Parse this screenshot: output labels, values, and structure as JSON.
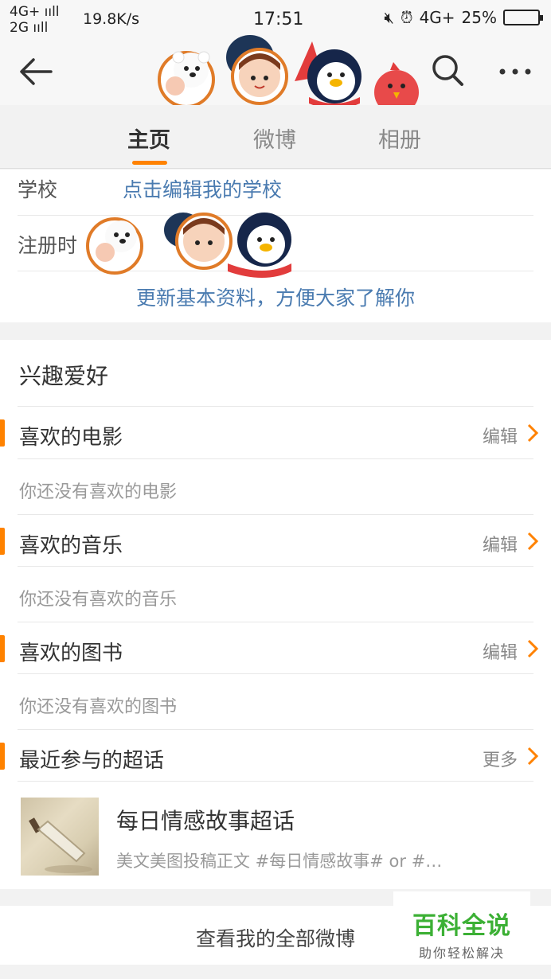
{
  "status_bar": {
    "network_1": "4G+ ııll",
    "network_2": "2G ııll",
    "speed": "19.8K/s",
    "time": "17:51",
    "signal_right": "4G+",
    "battery": "25%"
  },
  "tabs": [
    {
      "label": "主页",
      "active": true
    },
    {
      "label": "微博",
      "active": false
    },
    {
      "label": "相册",
      "active": false
    }
  ],
  "profile": {
    "school_key": "学校",
    "school_value": "点击编辑我的学校",
    "register_key": "注册时",
    "update_link": "更新基本资料，方便大家了解你"
  },
  "hobbies": {
    "title": "兴趣爱好",
    "items": [
      {
        "label": "喜欢的电影",
        "action": "编辑",
        "empty": "你还没有喜欢的电影"
      },
      {
        "label": "喜欢的音乐",
        "action": "编辑",
        "empty": "你还没有喜欢的音乐"
      },
      {
        "label": "喜欢的图书",
        "action": "编辑",
        "empty": "你还没有喜欢的图书"
      }
    ],
    "topics": {
      "label": "最近参与的超话",
      "action": "更多",
      "item_title": "每日情感故事超话",
      "item_desc": "美文美图投稿正文 #每日情感故事#  or #…"
    }
  },
  "all_weibo": "查看我的全部微博",
  "watermark": {
    "title": "百科全说",
    "subtitle": "助你轻松解决"
  },
  "colors": {
    "accent": "#ff8200",
    "link": "#4a7bb0",
    "watermark": "#3cb035"
  }
}
